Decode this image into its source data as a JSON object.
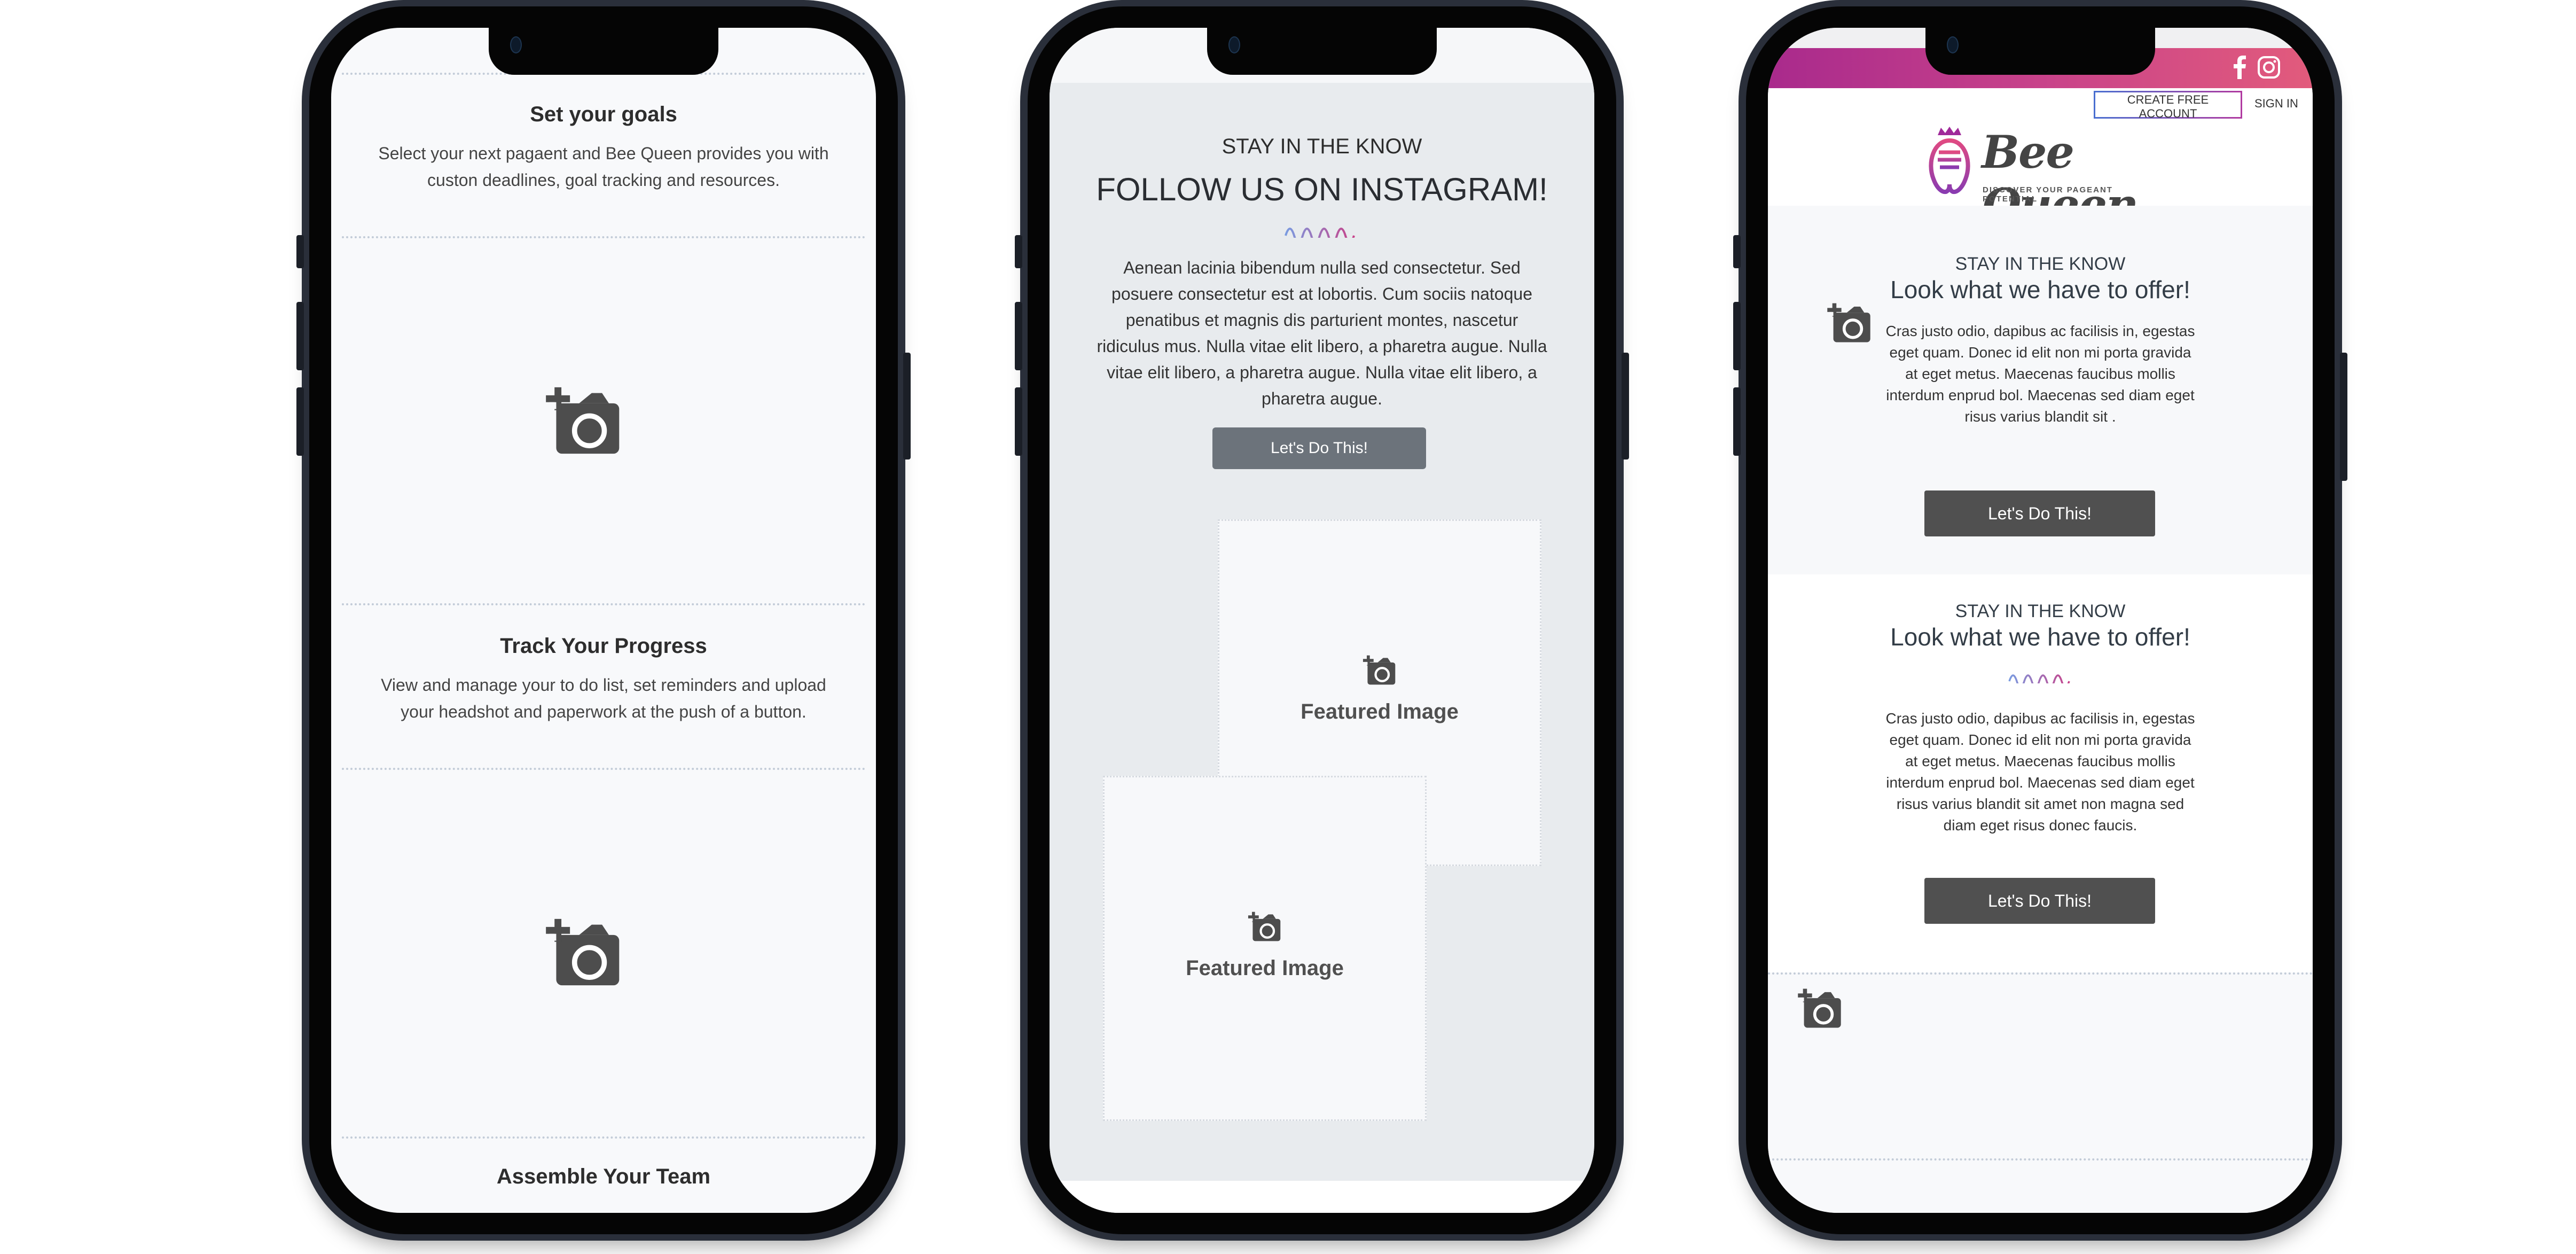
{
  "phones": {
    "left": {
      "sections": [
        {
          "title": "Set your goals",
          "body": "Select your next pagaent and Bee Queen provides you with custon deadlines, goal tracking and resources."
        },
        {
          "title": "Track Your Progress",
          "body": "View and manage your to do list, set reminders and upload your headshot and paperwork at the push of a button."
        },
        {
          "title": "Assemble Your Team"
        }
      ],
      "image_placeholder_icon": "add-photo-icon"
    },
    "middle": {
      "kicker": "STAY IN THE KNOW",
      "title": "FOLLOW US ON INSTAGRAM!",
      "body": "Aenean lacinia bibendum nulla sed consectetur. Sed posuere consectetur est at lobortis. Cum sociis natoque penatibus et magnis dis parturient montes, nascetur ridiculus mus. Nulla vitae elit libero, a pharetra augue. Nulla vitae elit libero, a pharetra augue. Nulla vitae elit libero, a pharetra augue.",
      "cta_label": "Let's Do This!",
      "featured_images": [
        {
          "label": "Featured Image"
        },
        {
          "label": "Featured Image"
        }
      ]
    },
    "right": {
      "social_icons": [
        "facebook-icon",
        "instagram-icon"
      ],
      "nav": {
        "create_account": "CREATE FREE ACCOUNT",
        "sign_in": "SIGN IN"
      },
      "logo": {
        "name": "Bee Queen",
        "tagline": "DISCOVER YOUR PAGEANT POTENTIAL"
      },
      "sections": [
        {
          "kicker": "STAY IN THE KNOW",
          "title": "Look what we have to offer!",
          "body": "Cras justo odio, dapibus ac facilisis in, egestas eget quam. Donec id elit non mi porta gravida at eget metus. Maecenas faucibus mollis interdum enprud bol. Maecenas sed diam eget risus varius blandit sit .",
          "cta_label": "Let's Do This!"
        },
        {
          "kicker": "STAY IN THE KNOW",
          "title": "Look what we have to offer!",
          "body": "Cras justo odio, dapibus ac facilisis in, egestas eget quam. Donec id elit non mi porta gravida at eget metus. Maecenas faucibus mollis interdum enprud bol. Maecenas sed diam eget risus varius blandit sit amet non magna sed diam eget risus donec faucis.",
          "cta_label": "Let's Do This!"
        }
      ]
    }
  },
  "colors": {
    "brand_gradient_start": "#a92a8c",
    "brand_gradient_end": "#e25b7c",
    "squiggle_start": "#7a9be0",
    "squiggle_end": "#c8428a",
    "button_gray": "#6c737b",
    "button_dark": "#505050",
    "icon_gray": "#4d4d4d"
  }
}
